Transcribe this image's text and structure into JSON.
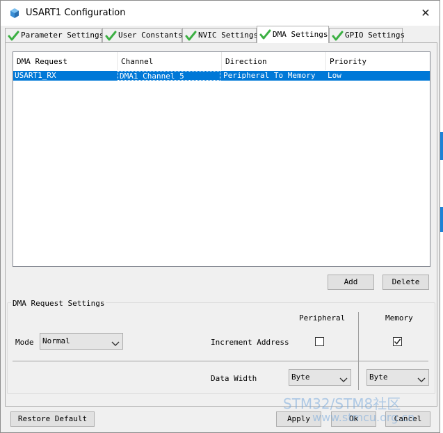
{
  "window": {
    "title": "USART1 Configuration"
  },
  "tabs": [
    {
      "label": "Parameter Settings",
      "active": false
    },
    {
      "label": "User Constants",
      "active": false
    },
    {
      "label": "NVIC Settings",
      "active": false
    },
    {
      "label": "DMA Settings",
      "active": true
    },
    {
      "label": "GPIO Settings",
      "active": false
    }
  ],
  "table": {
    "headers": [
      "DMA Request",
      "Channel",
      "Direction",
      "Priority"
    ],
    "rows": [
      {
        "request": "USART1_RX",
        "channel": "DMA1 Channel 5",
        "direction": "Peripheral To Memory",
        "priority": "Low"
      }
    ]
  },
  "table_buttons": {
    "add": "Add",
    "delete": "Delete"
  },
  "request_settings": {
    "group_title": "DMA Request Settings",
    "mode_label": "Mode",
    "mode_value": "Normal",
    "peripheral_header": "Peripheral",
    "memory_header": "Memory",
    "increment_label": "Increment Address",
    "peripheral_increment": false,
    "memory_increment": true,
    "data_width_label": "Data Width",
    "peripheral_width": "Byte",
    "memory_width": "Byte"
  },
  "footer": {
    "restore_default": "Restore Default",
    "apply": "Apply",
    "ok": "Ok",
    "cancel": "Cancel"
  },
  "watermark": {
    "text": "STM32/STM8社区",
    "url": "www.stmcu.org.cn"
  },
  "colors": {
    "selection": "#0078d7",
    "check_green": "#3cb043",
    "window_bg": "#f0f0f0"
  },
  "icons": {
    "app": "cube-icon",
    "tab_status": "green-check-icon",
    "close": "close-icon",
    "dropdown": "chevron-down-icon"
  }
}
